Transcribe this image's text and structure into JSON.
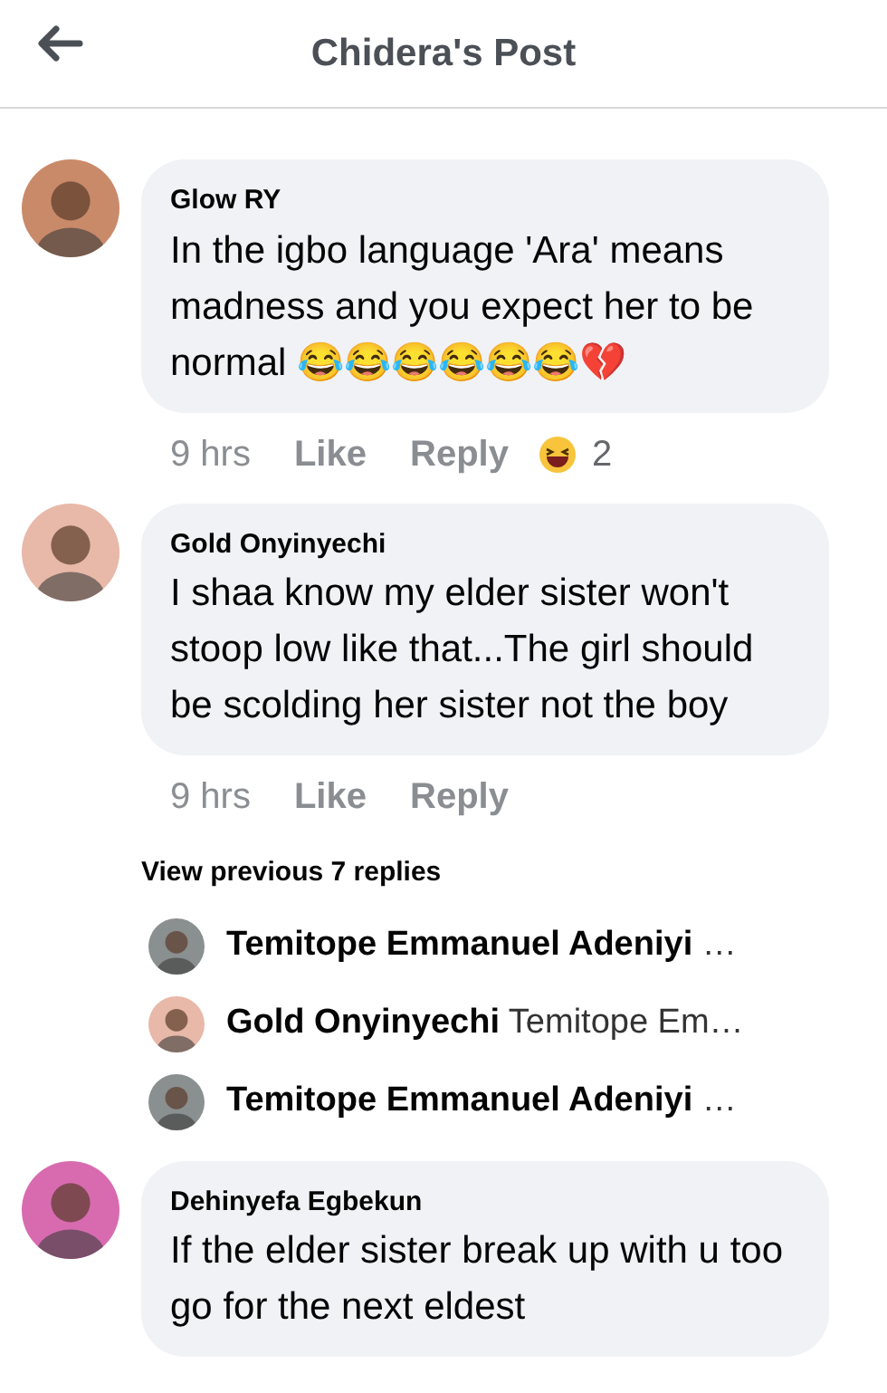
{
  "header": {
    "title": "Chidera's Post"
  },
  "comments": [
    {
      "name": "Glow RY",
      "text": "In the igbo language 'Ara' means madness and you expect her to be normal 😂😂😂😂😂😂💔",
      "time": "9 hrs",
      "like": "Like",
      "reply": "Reply",
      "reaction_count": "2"
    },
    {
      "name": "Gold Onyinyechi",
      "text": "I shaa know my elder sister won't stoop low like that...The girl should be scolding her sister not the boy",
      "time": "9 hrs",
      "like": "Like",
      "reply": "Reply"
    }
  ],
  "view_previous": "View previous 7 replies",
  "replies": [
    {
      "name": "Temitope Emmanuel Adeniyi",
      "text": "…"
    },
    {
      "name": "Gold Onyinyechi",
      "text": "Temitope Em…"
    },
    {
      "name": "Temitope Emmanuel Adeniyi",
      "text": "…"
    }
  ],
  "last_comment": {
    "name": "Dehinyefa Egbekun",
    "text": "If the elder sister break up with u too go for the next eldest"
  }
}
